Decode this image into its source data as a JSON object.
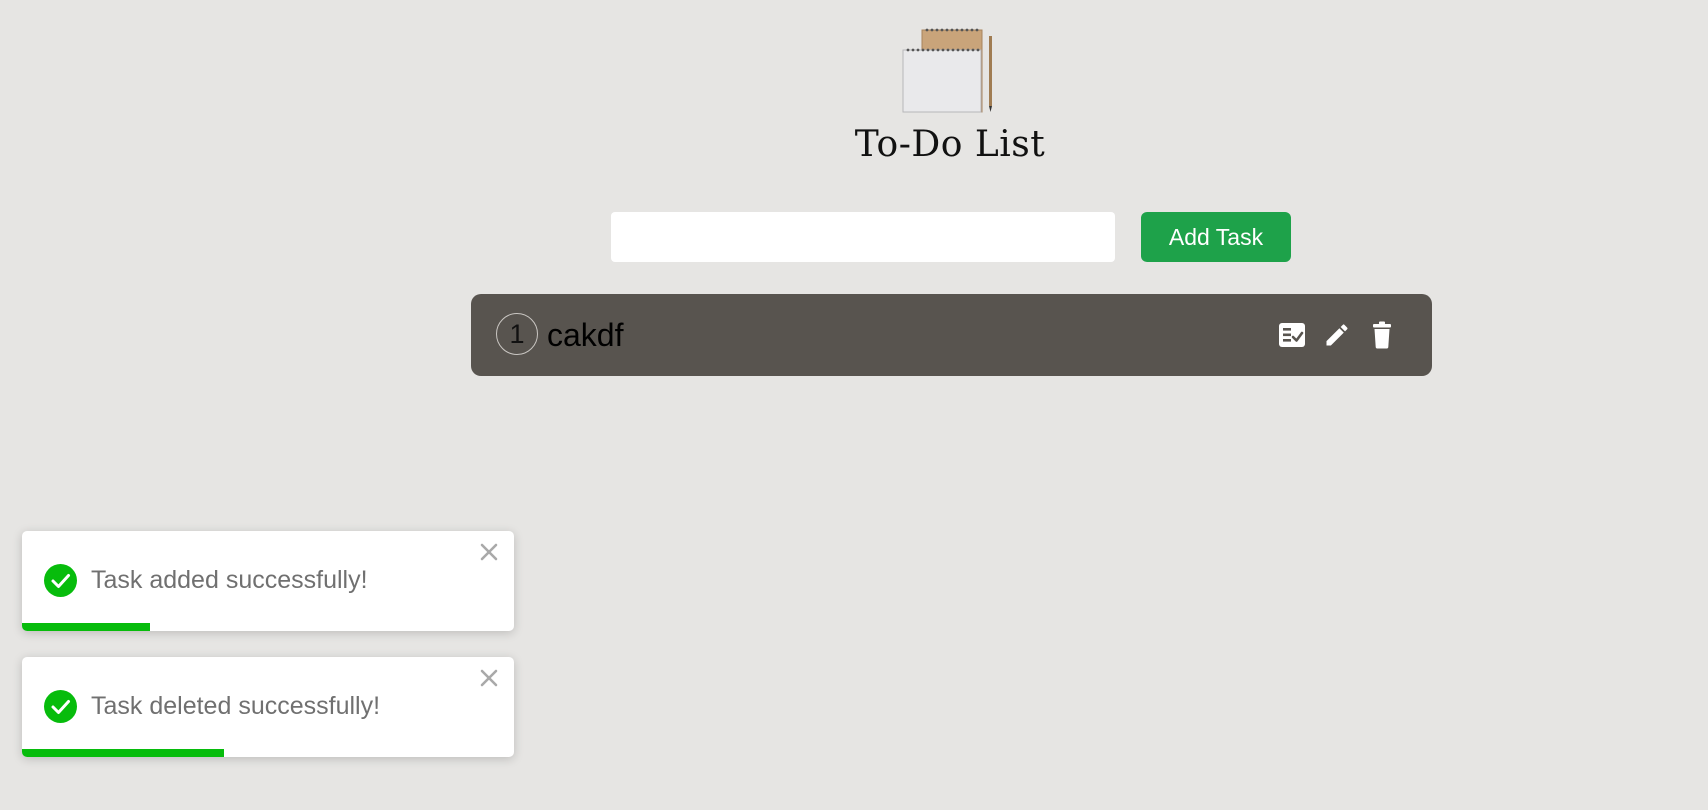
{
  "app": {
    "title": "To-Do List"
  },
  "input": {
    "value": "",
    "placeholder": ""
  },
  "add_button_label": "Add Task",
  "tasks": [
    {
      "index": "1",
      "text": "cakdf"
    }
  ],
  "task_actions": [
    "complete-icon",
    "edit-icon",
    "delete-icon"
  ],
  "toasts": [
    {
      "message": "Task added successfully!",
      "progress": 0.26,
      "type": "success"
    },
    {
      "message": "Task deleted successfully!",
      "progress": 0.41,
      "type": "success"
    }
  ],
  "colors": {
    "background": "#e6e5e3",
    "accent_button": "#1ea24a",
    "task_row": "#58544f",
    "toast_success": "#07bc0c"
  }
}
